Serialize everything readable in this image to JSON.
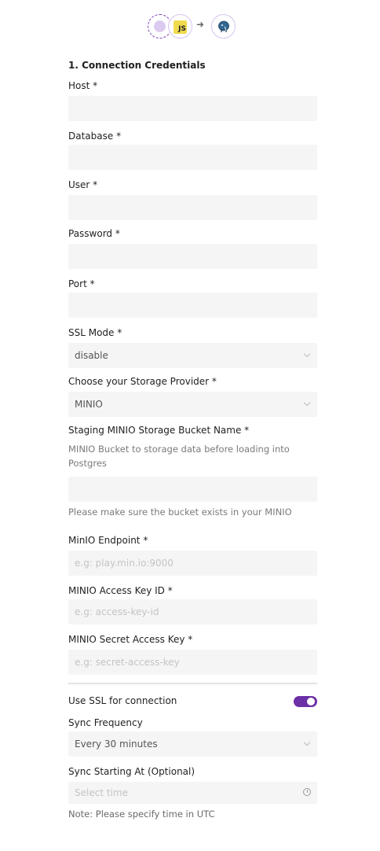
{
  "header": {
    "source_icon": "source-icon",
    "js_label": "JS",
    "arrow_icon": "right-arrow-icon",
    "destination_icon": "postgres-elephant-icon"
  },
  "form": {
    "section_title": "1. Connection Credentials",
    "host": {
      "label": "Host *",
      "value": ""
    },
    "database": {
      "label": "Database *",
      "value": ""
    },
    "user": {
      "label": "User *",
      "value": ""
    },
    "password": {
      "label": "Password *",
      "value": ""
    },
    "port": {
      "label": "Port *",
      "value": ""
    },
    "ssl_mode": {
      "label": "SSL Mode *",
      "value": "disable"
    },
    "storage_provider": {
      "label": "Choose your Storage Provider *",
      "value": "MINIO"
    },
    "bucket": {
      "label": "Staging MINIO Storage Bucket Name *",
      "description_line1": "MINIO Bucket to storage data before loading into",
      "description_line2": "Postgres",
      "value": "",
      "hint": "Please make sure the bucket exists in your MINIO"
    },
    "endpoint": {
      "label": "MinIO Endpoint *",
      "placeholder": "e.g: play.min.io:9000"
    },
    "access_key": {
      "label": "MINIO Access Key ID *",
      "placeholder": "e.g: access-key-id"
    },
    "secret_key": {
      "label": "MINIO Secret Access Key *",
      "placeholder": "e.g: secret-access-key"
    },
    "use_ssl": {
      "label": "Use SSL for connection",
      "enabled": true
    },
    "sync_frequency": {
      "label": "Sync Frequency",
      "value": "Every 30 minutes"
    },
    "sync_start": {
      "label": "Sync Starting At (Optional)",
      "placeholder": "Select time"
    },
    "note": "Note: Please specify time in UTC"
  },
  "colors": {
    "accent": "#6b2fa6",
    "input_bg": "#f5f5f5",
    "js_yellow": "#f0db4f"
  }
}
